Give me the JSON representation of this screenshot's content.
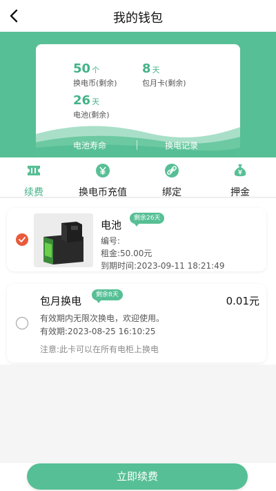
{
  "header": {
    "title": "我的钱包",
    "back_icon": "chevron-left-icon"
  },
  "wallet": {
    "stats": [
      {
        "value": "50",
        "unit": "个",
        "label": "换电币(剩余)"
      },
      {
        "value": "8",
        "unit": "天",
        "label": "包月卡(剩余)"
      },
      {
        "value": "26",
        "unit": "天",
        "label": "电池(剩余)"
      }
    ],
    "links": {
      "battery_life": "电池寿命",
      "swap_record": "换电记录"
    }
  },
  "tabs": [
    {
      "label": "续费",
      "icon": "ticket-icon",
      "active": true
    },
    {
      "label": "换电币充值",
      "icon": "yuan-coin-icon",
      "active": false
    },
    {
      "label": "绑定",
      "icon": "link-icon",
      "active": false
    },
    {
      "label": "押金",
      "icon": "money-bag-icon",
      "active": false
    }
  ],
  "items": [
    {
      "name": "电池",
      "badge": "剩余26天",
      "checked": true,
      "lines": [
        "编号:",
        "租金:50.00元",
        "到期时间:2023-09-11 18:21:49"
      ]
    },
    {
      "name": "包月换电",
      "badge": "剩余8天",
      "checked": false,
      "price": "0.01元",
      "lines": [
        "有效期内无限次换电，欢迎使用。",
        "有效期:2023-08-25 16:10:25"
      ],
      "note": "注意:此卡可以在所有电柜上换电"
    }
  ],
  "footer": {
    "button": "立即续费"
  },
  "colors": {
    "accent": "#57bf95",
    "check": "#e95a3b"
  }
}
